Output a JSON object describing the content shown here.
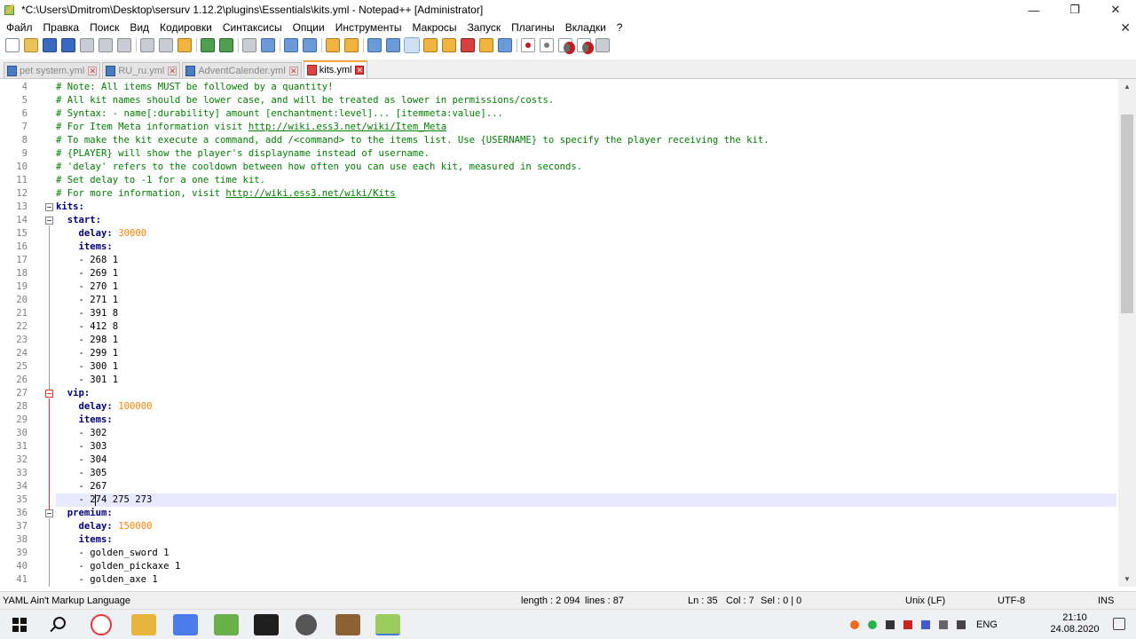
{
  "window": {
    "title": "*C:\\Users\\Dmitrom\\Desktop\\sersurv 1.12.2\\plugins\\Essentials\\kits.yml - Notepad++ [Administrator]",
    "minimize": "—",
    "restore": "❐",
    "close": "✕"
  },
  "menu": {
    "items": [
      "Файл",
      "Правка",
      "Поиск",
      "Вид",
      "Кодировки",
      "Синтаксисы",
      "Опции",
      "Инструменты",
      "Макросы",
      "Запуск",
      "Плагины",
      "Вкладки",
      "?"
    ],
    "close": "✕"
  },
  "tabs": [
    {
      "label": "pet system.yml",
      "active": false
    },
    {
      "label": "RU_ru.yml",
      "active": false
    },
    {
      "label": "AdventCalender.yml",
      "active": false
    },
    {
      "label": "kits.yml",
      "active": true
    }
  ],
  "editor": {
    "lines": [
      {
        "n": "4",
        "text": "# Note: All items MUST be followed by a quantity!"
      },
      {
        "n": "5",
        "text": "# All kit names should be lower case, and will be treated as lower in permissions/costs."
      },
      {
        "n": "6",
        "text": "# Syntax: - name[:durability] amount [enchantment:level]... [itemmeta:value]..."
      },
      {
        "n": "7",
        "text": "# For Item Meta information visit ",
        "link": "http://wiki.ess3.net/wiki/Item_Meta"
      },
      {
        "n": "8",
        "text": "# To make the kit execute a command, add /<command> to the items list. Use {USERNAME} to specify the player receiving the kit."
      },
      {
        "n": "9",
        "text": "# {PLAYER} will show the player's displayname instead of username."
      },
      {
        "n": "10",
        "text": "# 'delay' refers to the cooldown between how often you can use each kit, measured in seconds."
      },
      {
        "n": "11",
        "text": "# Set delay to -1 for a one time kit."
      },
      {
        "n": "12",
        "text": "# For more information, visit ",
        "link": "http://wiki.ess3.net/wiki/Kits"
      },
      {
        "n": "13",
        "key": "kits:",
        "indent": ""
      },
      {
        "n": "14",
        "key": "start:",
        "indent": "  "
      },
      {
        "n": "15",
        "key": "delay:",
        "num": "30000",
        "indent": "    "
      },
      {
        "n": "16",
        "key": "items:",
        "indent": "    "
      },
      {
        "n": "17",
        "val": "- 268 1",
        "indent": "    "
      },
      {
        "n": "18",
        "val": "- 269 1",
        "indent": "    "
      },
      {
        "n": "19",
        "val": "- 270 1",
        "indent": "    "
      },
      {
        "n": "20",
        "val": "- 271 1",
        "indent": "    "
      },
      {
        "n": "21",
        "val": "- 391 8",
        "indent": "    "
      },
      {
        "n": "22",
        "val": "- 412 8",
        "indent": "    "
      },
      {
        "n": "23",
        "val": "- 298 1",
        "indent": "    "
      },
      {
        "n": "24",
        "val": "- 299 1",
        "indent": "    "
      },
      {
        "n": "25",
        "val": "- 300 1",
        "indent": "    "
      },
      {
        "n": "26",
        "val": "- 301 1",
        "indent": "    "
      },
      {
        "n": "27",
        "key": "vip:",
        "indent": "  "
      },
      {
        "n": "28",
        "key": "delay:",
        "num": "100000",
        "indent": "    "
      },
      {
        "n": "29",
        "key": "items:",
        "indent": "    "
      },
      {
        "n": "30",
        "val": "- 302",
        "indent": "    "
      },
      {
        "n": "31",
        "val": "- 303",
        "indent": "    "
      },
      {
        "n": "32",
        "val": "- 304",
        "indent": "    "
      },
      {
        "n": "33",
        "val": "- 305",
        "indent": "    "
      },
      {
        "n": "34",
        "val": "- 267",
        "indent": "    "
      },
      {
        "n": "35",
        "val": "- 274 275 273",
        "indent": "    ",
        "current": true
      },
      {
        "n": "36",
        "key": "premium:",
        "indent": "  "
      },
      {
        "n": "37",
        "key": "delay:",
        "num": "150000",
        "indent": "    "
      },
      {
        "n": "38",
        "key": "items:",
        "indent": "    "
      },
      {
        "n": "39",
        "val": "- golden_sword 1",
        "indent": "    "
      },
      {
        "n": "40",
        "val": "- golden_pickaxe 1",
        "indent": "    "
      },
      {
        "n": "41",
        "val": "- golden_axe 1",
        "indent": "    "
      }
    ]
  },
  "status": {
    "language": "YAML Ain't Markup Language",
    "length": "length : 2 094",
    "lines": "lines : 87",
    "ln": "Ln : 35",
    "col": "Col : 7",
    "sel": "Sel : 0 | 0",
    "eol": "Unix (LF)",
    "encoding": "UTF-8",
    "mode": "INS"
  },
  "taskbar": {
    "lang": "ENG",
    "time": "21:10",
    "date": "24.08.2020"
  },
  "colors": {
    "comment": "#008000",
    "key": "#000080",
    "number": "#ff8000",
    "current_line": "#e8e8ff",
    "active_tab_accent": "#f9a637"
  }
}
